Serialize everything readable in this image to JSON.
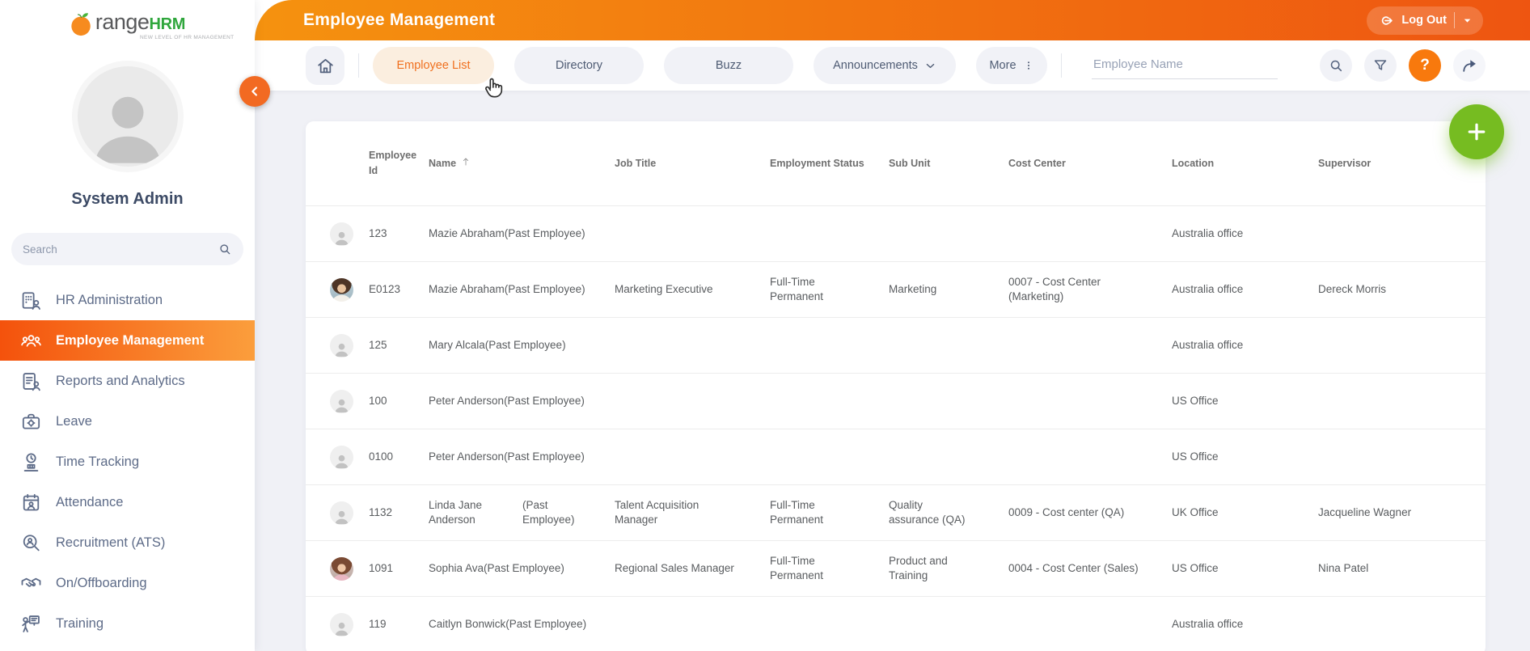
{
  "app": {
    "title": "Employee Management"
  },
  "brand": {
    "word_prefix": "range",
    "word_suffix": "HRM",
    "tagline": "NEW LEVEL OF HR MANAGEMENT"
  },
  "account": {
    "name": "System Admin",
    "logout_label": "Log Out"
  },
  "sidebar": {
    "search_placeholder": "Search",
    "items": [
      {
        "label": "HR Administration",
        "icon": "hr-administration-icon",
        "active": false
      },
      {
        "label": "Employee Management",
        "icon": "employee-management-icon",
        "active": true
      },
      {
        "label": "Reports and Analytics",
        "icon": "reports-analytics-icon",
        "active": false
      },
      {
        "label": "Leave",
        "icon": "leave-icon",
        "active": false
      },
      {
        "label": "Time Tracking",
        "icon": "time-tracking-icon",
        "active": false
      },
      {
        "label": "Attendance",
        "icon": "attendance-icon",
        "active": false
      },
      {
        "label": "Recruitment (ATS)",
        "icon": "recruitment-icon",
        "active": false
      },
      {
        "label": "On/Offboarding",
        "icon": "onboarding-icon",
        "active": false
      },
      {
        "label": "Training",
        "icon": "training-icon",
        "active": false
      }
    ]
  },
  "toolbar": {
    "tabs": [
      {
        "label": "Employee List",
        "active": true,
        "caret": false,
        "dots": false
      },
      {
        "label": "Directory",
        "active": false,
        "caret": false,
        "dots": false
      },
      {
        "label": "Buzz",
        "active": false,
        "caret": false,
        "dots": false
      },
      {
        "label": "Announcements",
        "active": false,
        "caret": true,
        "dots": false
      },
      {
        "label": "More",
        "active": false,
        "caret": false,
        "dots": true
      }
    ],
    "search_placeholder": "Employee Name",
    "help_label": "?"
  },
  "table": {
    "columns": [
      "Employee Id",
      "Name",
      "Job Title",
      "Employment Status",
      "Sub Unit",
      "Cost Center",
      "Location",
      "Supervisor"
    ],
    "sort": {
      "column": "Name",
      "direction": "ascending"
    },
    "rows": [
      {
        "avatar": "placeholder",
        "id": "123",
        "name": "Mazie Abraham(Past Employee)",
        "name_suffix": "",
        "job": "",
        "status": "",
        "sub_unit": "",
        "cost_center": "",
        "location": "Australia office",
        "supervisor": ""
      },
      {
        "avatar": "photo-female-1",
        "id": "E0123",
        "name": "Mazie Abraham(Past Employee)",
        "name_suffix": "",
        "job": "Marketing Executive",
        "status": "Full-Time Permanent",
        "sub_unit": "Marketing",
        "cost_center": "0007 - Cost Center (Marketing)",
        "location": "Australia office",
        "supervisor": "Dereck Morris"
      },
      {
        "avatar": "placeholder",
        "id": "125",
        "name": "Mary Alcala(Past Employee)",
        "name_suffix": "",
        "job": "",
        "status": "",
        "sub_unit": "",
        "cost_center": "",
        "location": "Australia office",
        "supervisor": ""
      },
      {
        "avatar": "placeholder",
        "id": "100",
        "name": "Peter Anderson(Past Employee)",
        "name_suffix": "",
        "job": "",
        "status": "",
        "sub_unit": "",
        "cost_center": "",
        "location": "US Office",
        "supervisor": ""
      },
      {
        "avatar": "placeholder",
        "id": "0100",
        "name": "Peter Anderson(Past Employee)",
        "name_suffix": "",
        "job": "",
        "status": "",
        "sub_unit": "",
        "cost_center": "",
        "location": "US Office",
        "supervisor": ""
      },
      {
        "avatar": "placeholder",
        "id": "1132",
        "name": "Linda Jane Anderson",
        "name_suffix": "(Past Employee)",
        "job": "Talent Acquisition Manager",
        "status": "Full-Time Permanent",
        "sub_unit": "Quality assurance (QA)",
        "cost_center": "0009 - Cost center (QA)",
        "location": "UK Office",
        "supervisor": "Jacqueline Wagner"
      },
      {
        "avatar": "photo-female-2",
        "id": "1091",
        "name": "Sophia Ava(Past Employee)",
        "name_suffix": "",
        "job": "Regional Sales Manager",
        "status": "Full-Time Permanent",
        "sub_unit": "Product and Training",
        "cost_center": "0004 - Cost Center (Sales)",
        "location": "US Office",
        "supervisor": "Nina Patel"
      },
      {
        "avatar": "placeholder",
        "id": "119",
        "name": "Caitlyn Bonwick(Past Employee)",
        "name_suffix": "",
        "job": "",
        "status": "",
        "sub_unit": "",
        "cost_center": "",
        "location": "Australia office",
        "supervisor": ""
      }
    ]
  },
  "colors": {
    "page_bg": "#F0F1F6",
    "header_grad_1": "#F5920F",
    "header_grad_2": "#EE5511",
    "active_grad_1": "#F4520C",
    "active_grad_2": "#FB9E3C",
    "active_pill_bg": "#FBEEDF",
    "active_pill_text": "#F0701F",
    "pill_bg": "#F1F2F7",
    "pill_text": "#4E5B73",
    "sidebar_text": "#5D6B88",
    "collapse_orange": "#F26A22",
    "help_orange": "#F8790D",
    "fab_green": "#76BC21",
    "th_text": "#6E6E6E",
    "cell_text": "#595C5F",
    "divider": "#ECECEC",
    "brand_green": "#2FA63C",
    "brand_orange": "#F68B1F"
  }
}
